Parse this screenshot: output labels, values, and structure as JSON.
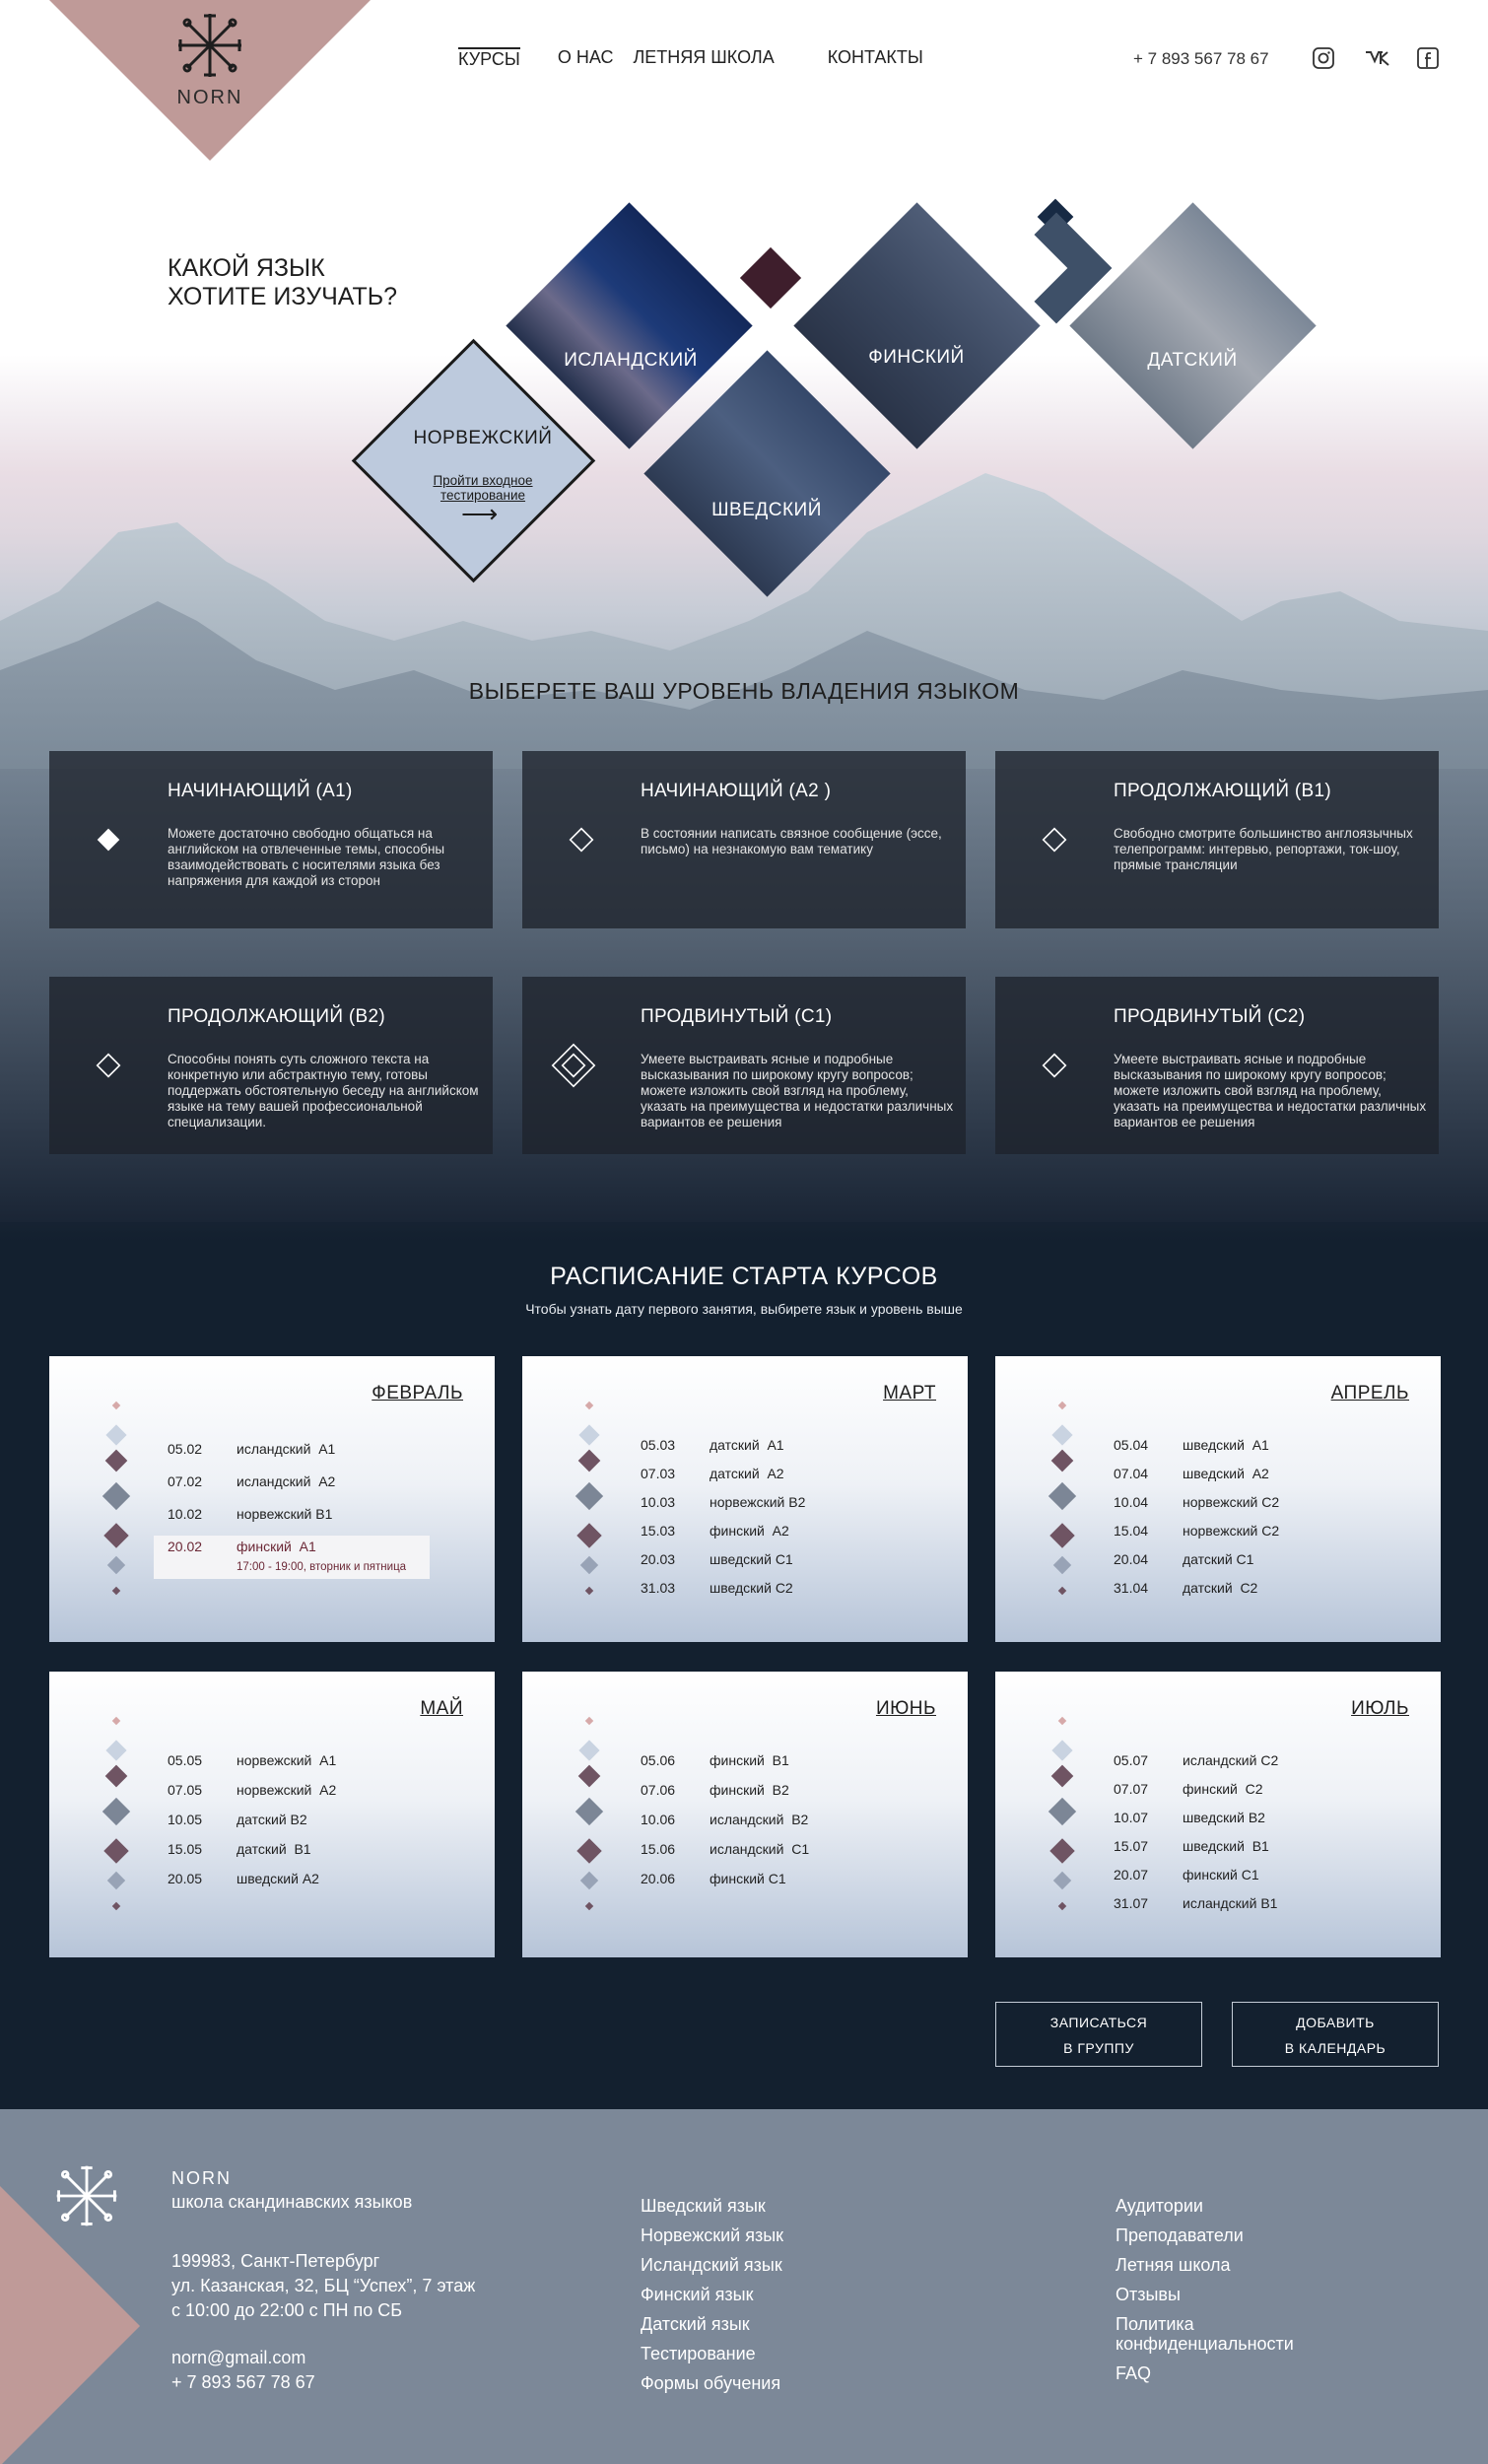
{
  "brand": {
    "name": "NORN",
    "triangle_color": "#bf9a98"
  },
  "nav": {
    "items": [
      "КУРСЫ",
      "О НАС",
      "ЛЕТНЯЯ ШКОЛА",
      "КОНТАКТЫ"
    ],
    "phone": "+ 7 893 567 78 67",
    "social": [
      "instagram-icon",
      "vk-icon",
      "facebook-icon"
    ]
  },
  "hero": {
    "question_line1": "КАКОЙ ЯЗЫК",
    "question_line2": "ХОТИТЕ ИЗУЧАТЬ?",
    "languages": {
      "iceland": "ИСЛАНДСКИЙ",
      "finland": "ФИНСКИЙ",
      "denmark": "ДАТСКИЙ",
      "sweden": "ШВЕДСКИЙ",
      "norway": "НОРВЕЖСКИЙ"
    },
    "test_line1": "Пройти входное",
    "test_line2": "тестирование",
    "test_arrow": "⟶"
  },
  "levels": {
    "title": "ВЫБЕРЕТЕ ВАШ УРОВЕНЬ ВЛАДЕНИЯ ЯЗЫКОМ",
    "cards": [
      {
        "title": "НАЧИНАЮЩИЙ (А1)",
        "desc": "Можете достаточно свободно общаться на английском на отвлеченные темы, способны взаимодействовать с носителями языка без напряжения для каждой из сторон"
      },
      {
        "title": "НАЧИНАЮЩИЙ (А2 )",
        "desc": "В состоянии написать связное сообщение (эссе, письмо) на незнакомую вам тематику"
      },
      {
        "title": "ПРОДОЛЖАЮЩИЙ (В1)",
        "desc": "Свободно смотрите большинство англоязычных телепрограмм: интервью, репортажи, ток-шоу, прямые трансляции"
      },
      {
        "title": "ПРОДОЛЖАЮЩИЙ (В2)",
        "desc": "Способны понять суть сложного текста на конкретную или абстрактную тему, готовы поддержать обстоятельную беседу на английском языке на тему вашей профессиональной специализации."
      },
      {
        "title": "ПРОДВИНУТЫЙ (С1)",
        "desc": "Умеете выстраивать ясные и подробные высказывания по широкому кругу вопросов; можете изложить свой взгляд на проблему, указать на преимущества и недостатки различных вариантов ее решения"
      },
      {
        "title": "ПРОДВИНУТЫЙ (С2)",
        "desc": "Умеете выстраивать ясные и подробные высказывания по широкому кругу вопросов; можете изложить свой взгляд на проблему, указать на преимущества и недостатки различных вариантов ее решения"
      }
    ]
  },
  "schedule": {
    "title": "РАСПИСАНИЕ СТАРТА КУРСОВ",
    "subtitle": "Чтобы узнать дату первого занятия, выбирете язык и уровень выше",
    "months": [
      {
        "name": "ФЕВРАЛЬ",
        "rows": [
          [
            "05.02",
            "исландский  А1"
          ],
          [
            "07.02",
            "исландский  А2"
          ],
          [
            "10.02",
            "норвежский В1"
          ],
          [
            "20.02",
            "финский  А1"
          ]
        ],
        "note": "17:00 - 19:00, вторник и пятница"
      },
      {
        "name": "МАРТ",
        "rows": [
          [
            "05.03",
            "датский  А1"
          ],
          [
            "07.03",
            "датский  А2"
          ],
          [
            "10.03",
            "норвежский В2"
          ],
          [
            "15.03",
            "финский  А2"
          ],
          [
            "20.03",
            "шведский С1"
          ],
          [
            "31.03",
            "шведский С2"
          ]
        ]
      },
      {
        "name": "АПРЕЛЬ",
        "rows": [
          [
            "05.04",
            "шведский  А1"
          ],
          [
            "07.04",
            "шведский  А2"
          ],
          [
            "10.04",
            "норвежский С2"
          ],
          [
            "15.04",
            "норвежский С2"
          ],
          [
            "20.04",
            "датский С1"
          ],
          [
            "31.04",
            "датский  С2"
          ]
        ]
      },
      {
        "name": "МАЙ",
        "rows": [
          [
            "05.05",
            "норвежский  А1"
          ],
          [
            "07.05",
            "норвежский  А2"
          ],
          [
            "10.05",
            "датский В2"
          ],
          [
            "15.05",
            "датский  В1"
          ],
          [
            "20.05",
            "шведский А2"
          ]
        ]
      },
      {
        "name": "ИЮНЬ",
        "rows": [
          [
            "05.06",
            "финский  В1"
          ],
          [
            "07.06",
            "финский  В2"
          ],
          [
            "10.06",
            "исландский  В2"
          ],
          [
            "15.06",
            "исландский  С1"
          ],
          [
            "20.06",
            "финский С1"
          ]
        ]
      },
      {
        "name": "ИЮЛЬ",
        "rows": [
          [
            "05.07",
            "исландский С2"
          ],
          [
            "07.07",
            "финский  С2"
          ],
          [
            "10.07",
            "шведский В2"
          ],
          [
            "15.07",
            "шведский  В1"
          ],
          [
            "20.07",
            "финский С1"
          ],
          [
            "31.07",
            "исландский В1"
          ]
        ]
      }
    ],
    "button_signup_line1": "ЗАПИСАТЬСЯ",
    "button_signup_line2": "В ГРУППУ",
    "button_calendar_line1": "ДОБАВИТЬ",
    "button_calendar_line2": "В  КАЛЕНДАРЬ"
  },
  "footer": {
    "brand": "NORN",
    "tagline": "школа скандинавских языков",
    "address_line1": "199983, Санкт-Петербург",
    "address_line2": "ул. Казанская, 32, БЦ “Успех”, 7 этаж",
    "address_line3": "с 10:00 до 22:00 с ПН по СБ",
    "email": "norn@gmail.com",
    "phone": "+ 7 893 567 78 67",
    "languages": [
      "Шведский язык",
      "Норвежский язык",
      "Исландский язык",
      "Финский язык",
      "Датский язык",
      "Тестирование",
      "Формы обучения"
    ],
    "links": [
      "Аудитории",
      "Преподаватели",
      "Летняя школа",
      "Отзывы",
      "Политика конфиденциальности",
      "FAQ"
    ]
  }
}
